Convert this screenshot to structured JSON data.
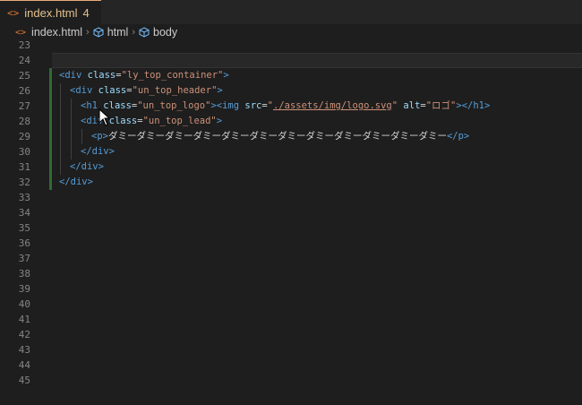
{
  "tab": {
    "icon": "<>",
    "filename": "index.html",
    "problem_count": "4",
    "close": "×"
  },
  "breadcrumb": {
    "file_icon": "<>",
    "file": "index.html",
    "item1": "html",
    "item2": "body",
    "separator": "›"
  },
  "line_numbers": [
    "23",
    "24",
    "25",
    "26",
    "27",
    "28",
    "29",
    "30",
    "31",
    "32",
    "33",
    "34",
    "35",
    "36",
    "37",
    "38",
    "39",
    "40",
    "41",
    "42",
    "43",
    "44",
    "45"
  ],
  "code": {
    "l25": {
      "open": "<div",
      "attr": "class",
      "eq": "=",
      "val": "\"ly_top_container\"",
      "close": ">"
    },
    "l26": {
      "open": "<div",
      "attr": "class",
      "eq": "=",
      "val": "\"un_top_header\"",
      "close": ">"
    },
    "l27": {
      "open": "<h1",
      "attr": "class",
      "eq": "=",
      "val": "\"un_top_logo\"",
      "close": ">",
      "img_open": "<img",
      "src_attr": "src",
      "src_eq": "=",
      "q1": "\"",
      "src_val": "./assets/img/logo.svg",
      "q2": "\"",
      "alt_attr": "alt",
      "alt_eq": "=",
      "alt_val": "\"ロゴ\"",
      "end": "></h1>"
    },
    "l28": {
      "open": "<div",
      "attr": "class",
      "eq": "=",
      "val": "\"un_top_lead\"",
      "close": ">"
    },
    "l29": {
      "open": "<p>",
      "text": "ダミーダミーダミーダミーダミーダミーダミーダミーダミーダミーダミーダミー",
      "close": "</p>"
    },
    "l30": {
      "tag": "</div>"
    },
    "l31": {
      "tag": "</div>"
    },
    "l32": {
      "tag": "</div>"
    }
  }
}
